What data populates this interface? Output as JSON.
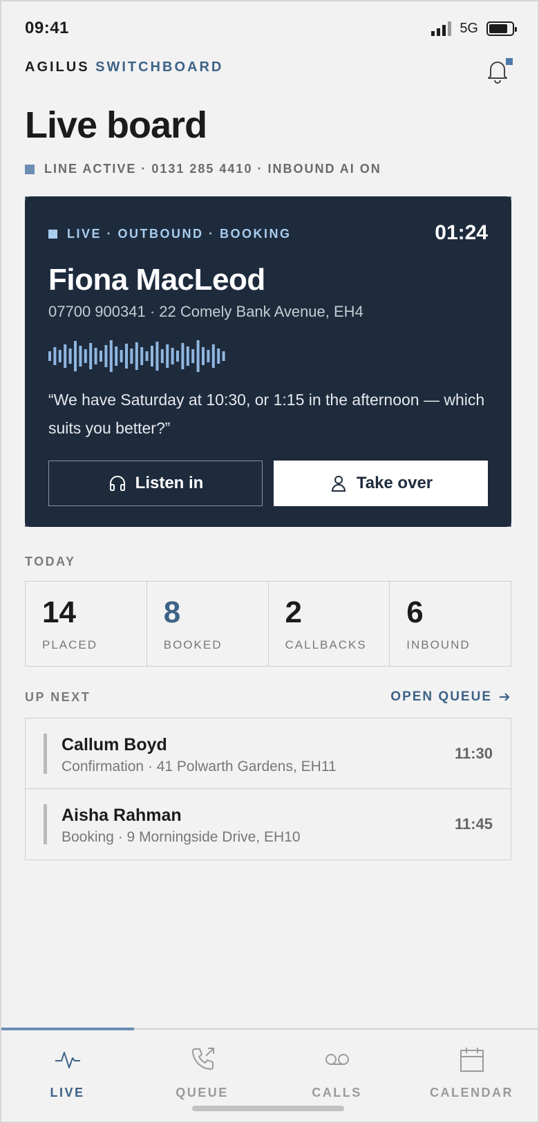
{
  "status_bar": {
    "time": "09:41",
    "network": "5G"
  },
  "header": {
    "brand_primary": "AGILUS",
    "brand_secondary": "SWITCHBOARD",
    "notification_icon": "bell-icon"
  },
  "page": {
    "title": "Live board",
    "line_status": "LINE ACTIVE · 0131 285 4410 · INBOUND AI ON"
  },
  "live_call": {
    "tag": "LIVE · OUTBOUND · BOOKING",
    "timer": "01:24",
    "caller_name": "Fiona MacLeod",
    "caller_details": "07700 900341 · 22 Comely Bank Avenue, EH4",
    "quote": "“We have Saturday at 10:30, or 1:15 in the afternoon — which suits you better?”",
    "listen_label": "Listen in",
    "take_over_label": "Take over"
  },
  "today": {
    "label": "TODAY",
    "stats": [
      {
        "value": "14",
        "label": "PLACED"
      },
      {
        "value": "8",
        "label": "BOOKED"
      },
      {
        "value": "2",
        "label": "CALLBACKS"
      },
      {
        "value": "6",
        "label": "INBOUND"
      }
    ]
  },
  "up_next": {
    "label": "UP NEXT",
    "open_queue_label": "OPEN QUEUE",
    "items": [
      {
        "name": "Callum Boyd",
        "detail": "Confirmation · 41 Polwarth Gardens, EH11",
        "time": "11:30"
      },
      {
        "name": "Aisha Rahman",
        "detail": "Booking · 9 Morningside Drive, EH10",
        "time": "11:45"
      }
    ]
  },
  "tab_bar": {
    "tabs": [
      {
        "label": "LIVE",
        "icon": "pulse-icon",
        "active": true
      },
      {
        "label": "QUEUE",
        "icon": "phone-outgoing-icon",
        "active": false
      },
      {
        "label": "CALLS",
        "icon": "voicemail-icon",
        "active": false
      },
      {
        "label": "CALENDAR",
        "icon": "calendar-icon",
        "active": false
      }
    ]
  },
  "colors": {
    "accent": "#3d6287",
    "card_bg": "#1e2b3d",
    "live_tag": "#a8cdf0",
    "background": "#f2f2f2"
  }
}
